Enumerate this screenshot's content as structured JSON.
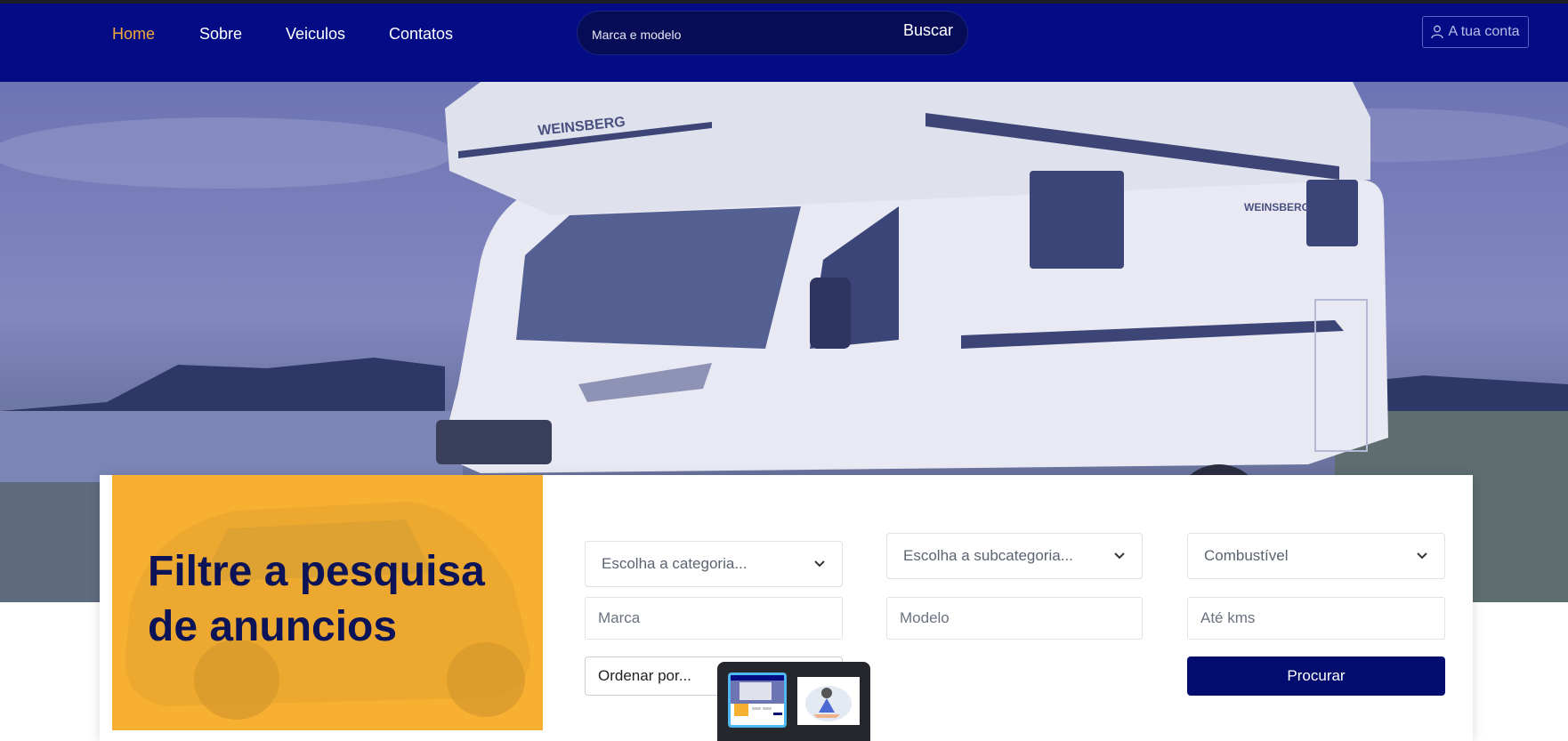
{
  "nav": {
    "links": [
      {
        "label": "Home",
        "active": true
      },
      {
        "label": "Sobre",
        "active": false
      },
      {
        "label": "Veiculos",
        "active": false
      },
      {
        "label": "Contatos",
        "active": false
      }
    ],
    "search": {
      "placeholder": "Marca e modelo",
      "button_label": "Buscar"
    },
    "account_label": "A tua conta",
    "account_icon": "user-icon"
  },
  "hero": {
    "vehicle_brand_text": "WEINSBERG"
  },
  "filter": {
    "title": "Filtre a pesquisa\nde anuncios",
    "category_select": "Escolha a categoria...",
    "subcategory_select": "Escolha a subcategoria...",
    "fuel_select": "Combustível",
    "brand_placeholder": "Marca",
    "model_placeholder": "Modelo",
    "kms_placeholder": "Até kms",
    "order_select": "Ordenar por...",
    "submit_label": "Procurar"
  },
  "colors": {
    "navbar": "#030c85",
    "accent": "#f4a93a",
    "promo": "#f8b032",
    "button": "#030c6f"
  },
  "task_switcher": {
    "thumbnails": [
      "current-tab-thumbnail",
      "other-tab-thumbnail"
    ]
  }
}
